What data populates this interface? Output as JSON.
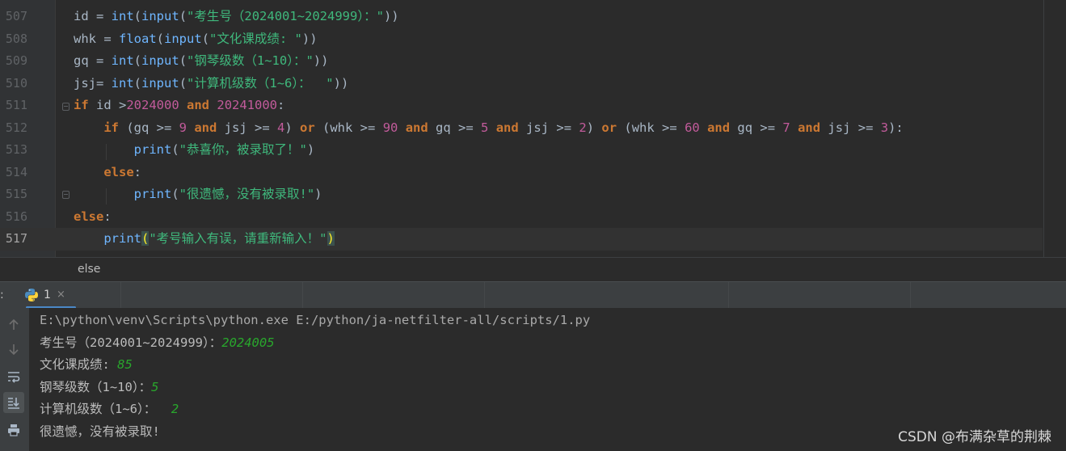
{
  "editor": {
    "lines": [
      {
        "num": "507",
        "tokens": [
          {
            "t": "id",
            "c": "ident"
          },
          {
            "t": " = ",
            "c": "op"
          },
          {
            "t": "int",
            "c": "fn"
          },
          {
            "t": "(",
            "c": "op"
          },
          {
            "t": "input",
            "c": "fn"
          },
          {
            "t": "(",
            "c": "op"
          },
          {
            "t": "\"考生号（2024001~2024999）：\"",
            "c": "str2"
          },
          {
            "t": "))",
            "c": "op"
          }
        ]
      },
      {
        "num": "508",
        "tokens": [
          {
            "t": "whk",
            "c": "ident"
          },
          {
            "t": " = ",
            "c": "op"
          },
          {
            "t": "float",
            "c": "fn"
          },
          {
            "t": "(",
            "c": "op"
          },
          {
            "t": "input",
            "c": "fn"
          },
          {
            "t": "(",
            "c": "op"
          },
          {
            "t": "\"文化课成绩: \"",
            "c": "str2"
          },
          {
            "t": "))",
            "c": "op"
          }
        ]
      },
      {
        "num": "509",
        "tokens": [
          {
            "t": "gq",
            "c": "ident"
          },
          {
            "t": " = ",
            "c": "op"
          },
          {
            "t": "int",
            "c": "fn"
          },
          {
            "t": "(",
            "c": "op"
          },
          {
            "t": "input",
            "c": "fn"
          },
          {
            "t": "(",
            "c": "op"
          },
          {
            "t": "\"钢琴级数（1~10）：\"",
            "c": "str2"
          },
          {
            "t": "))",
            "c": "op"
          }
        ]
      },
      {
        "num": "510",
        "tokens": [
          {
            "t": "jsj",
            "c": "ident"
          },
          {
            "t": "= ",
            "c": "op"
          },
          {
            "t": "int",
            "c": "fn"
          },
          {
            "t": "(",
            "c": "op"
          },
          {
            "t": "input",
            "c": "fn"
          },
          {
            "t": "(",
            "c": "op"
          },
          {
            "t": "\"计算机级数（1~6）：  \"",
            "c": "str2"
          },
          {
            "t": "))",
            "c": "op"
          }
        ]
      },
      {
        "num": "511",
        "tokens": [
          {
            "t": "if",
            "c": "kw"
          },
          {
            "t": " id >",
            "c": "op"
          },
          {
            "t": "2024000",
            "c": "num"
          },
          {
            "t": " ",
            "c": "op"
          },
          {
            "t": "and",
            "c": "kw"
          },
          {
            "t": " ",
            "c": "op"
          },
          {
            "t": "20241000",
            "c": "num"
          },
          {
            "t": ":",
            "c": "op"
          }
        ]
      },
      {
        "num": "512",
        "tokens": [
          {
            "t": "    ",
            "c": "op"
          },
          {
            "t": "if",
            "c": "kw"
          },
          {
            "t": " (gq >= ",
            "c": "op"
          },
          {
            "t": "9",
            "c": "num"
          },
          {
            "t": " ",
            "c": "op"
          },
          {
            "t": "and",
            "c": "kw"
          },
          {
            "t": " jsj >= ",
            "c": "op"
          },
          {
            "t": "4",
            "c": "num"
          },
          {
            "t": ") ",
            "c": "op"
          },
          {
            "t": "or",
            "c": "kw"
          },
          {
            "t": " (whk >= ",
            "c": "op"
          },
          {
            "t": "90",
            "c": "num"
          },
          {
            "t": " ",
            "c": "op"
          },
          {
            "t": "and",
            "c": "kw"
          },
          {
            "t": " gq >= ",
            "c": "op"
          },
          {
            "t": "5",
            "c": "num"
          },
          {
            "t": " ",
            "c": "op"
          },
          {
            "t": "and",
            "c": "kw"
          },
          {
            "t": " jsj >= ",
            "c": "op"
          },
          {
            "t": "2",
            "c": "num"
          },
          {
            "t": ") ",
            "c": "op"
          },
          {
            "t": "or",
            "c": "kw"
          },
          {
            "t": " (whk >= ",
            "c": "op"
          },
          {
            "t": "60",
            "c": "num"
          },
          {
            "t": " ",
            "c": "op"
          },
          {
            "t": "and",
            "c": "kw"
          },
          {
            "t": " gq >= ",
            "c": "op"
          },
          {
            "t": "7",
            "c": "num"
          },
          {
            "t": " ",
            "c": "op"
          },
          {
            "t": "and",
            "c": "kw"
          },
          {
            "t": " jsj >= ",
            "c": "op"
          },
          {
            "t": "3",
            "c": "num"
          },
          {
            "t": "):",
            "c": "op"
          }
        ]
      },
      {
        "num": "513",
        "tokens": [
          {
            "t": "        ",
            "c": "op"
          },
          {
            "t": "print",
            "c": "fn"
          },
          {
            "t": "(",
            "c": "op"
          },
          {
            "t": "\"恭喜你，被录取了！\"",
            "c": "str2"
          },
          {
            "t": ")",
            "c": "op"
          }
        ]
      },
      {
        "num": "514",
        "tokens": [
          {
            "t": "    ",
            "c": "op"
          },
          {
            "t": "else",
            "c": "kw"
          },
          {
            "t": ":",
            "c": "op"
          }
        ]
      },
      {
        "num": "515",
        "tokens": [
          {
            "t": "        ",
            "c": "op"
          },
          {
            "t": "print",
            "c": "fn"
          },
          {
            "t": "(",
            "c": "op"
          },
          {
            "t": "\"很遗憾，没有被录取!\"",
            "c": "str2"
          },
          {
            "t": ")",
            "c": "op"
          }
        ]
      },
      {
        "num": "516",
        "tokens": [
          {
            "t": "else",
            "c": "kw"
          },
          {
            "t": ":",
            "c": "op"
          }
        ]
      },
      {
        "num": "517",
        "tokens": [
          {
            "t": "    ",
            "c": "op"
          },
          {
            "t": "print",
            "c": "fn"
          },
          {
            "t": "(",
            "c": "paren-hl"
          },
          {
            "t": "\"考号输入有误，请重新输入！\"",
            "c": "str2"
          },
          {
            "t": ")",
            "c": "paren-hl"
          }
        ]
      }
    ],
    "current_line": "517"
  },
  "breadcrumb": {
    "item": "else"
  },
  "run": {
    "label": ":",
    "tab_label": "1",
    "close_glyph": "×",
    "icons": [
      "rerun-up-icon",
      "down-arrow-icon",
      "soft-wrap-icon",
      "scroll-to-end-icon",
      "print-icon"
    ]
  },
  "console": {
    "command": "E:\\python\\venv\\Scripts\\python.exe E:/python/ja-netfilter-all/scripts/1.py",
    "prompts": [
      {
        "prompt": "考生号（2024001~2024999）：",
        "input": "2024005"
      },
      {
        "prompt": "文化课成绩: ",
        "input": "85"
      },
      {
        "prompt": "钢琴级数（1~10）：",
        "input": "5"
      },
      {
        "prompt": "计算机级数（1~6）：  ",
        "input": "2"
      }
    ],
    "result": "很遗憾，没有被录取!"
  },
  "watermark": "CSDN @布满杂草的荆棘",
  "colors": {
    "keyword": "#cc7832",
    "string": "#3fb87c",
    "number": "#c25b9b",
    "function": "#6fb6ff",
    "user_input": "#29a62c"
  }
}
